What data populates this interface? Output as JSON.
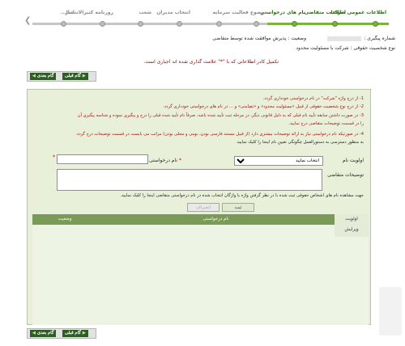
{
  "steps": [
    {
      "label": "اطلاعات عمومی شرکت",
      "done": true
    },
    {
      "label": "اطلاعات متقاضی",
      "done": true
    },
    {
      "label": "نام های درخواستی",
      "done": true
    },
    {
      "label": "موضوع فعالیت",
      "done": false
    },
    {
      "label": "سرمایه",
      "done": false
    },
    {
      "label": "انتخاب مدیران",
      "done": false
    },
    {
      "label": "شعب",
      "done": false
    },
    {
      "label": "روزنامه کثیرالانتشار",
      "done": false
    },
    {
      "label": "اسا...",
      "done": false
    }
  ],
  "info": {
    "tracking_label": "شماره پیگیری :",
    "status_label": "وضعیت : پذیرش موافقت شده توسط متقاضی",
    "entity_type": "نوع شخصیت حقوقی : شرکت با مسئولیت محدود",
    "instruction": "تکمیل کادر اطلاعاتی که با \"*\" علامت گذاری شده اند اجباری است."
  },
  "nav": {
    "next_label": "گام بعدی",
    "prev_label": "گام قبلی"
  },
  "notes": [
    "1- از درج واژه \"شرکت\" در نام درخواستی خودداری گردد.",
    "2- از درج نوع شخصیت حقوقی از قبیل «مسئولیت محدود» و «تضامنی» و ... در نام های درخواستی خودداری گردد.",
    "3- در صورت داشتن سابقه تأیید نام قبلی که به دلیل قانونی دیگر، در مرحله ثبت تأیید شده باشد، صرفاً نام تأیید شده قبلی را درج و پیگیری نموده و شناسه پیگیری آن",
    "را در قسمت توضیحات متقاضی درج نمایید.",
    "4- در صورتیکه نام درخواستی نیاز به ارائه توضیحات بیشتری دارد (از قبیل مستند فارسی بودن، بومی و محلی بودن) مراتب می بایست در قسمت توضیحات درج گردد.",
    "به منظور دسترسی به دستورالعمل چگونگی تعیین نام اینجا را کلیک نمایید."
  ],
  "form": {
    "priority_label": "اولویت نام",
    "requested_name_label": "نام درخواستی",
    "select_placeholder": "انتخاب نمایید",
    "desc_label": "توضیحات متقاضی",
    "hint": "جهت مشاهده نام های اشخاص حقوقی ثبت شده با در نظر گرفتن واژه یا واژگان انتخاب شده در نام درخواستی متقاضی اینجا را کلیک نمایید.",
    "submit_label": "ثبت",
    "cancel_label": "انصراف"
  },
  "table": {
    "priority": "اولویت",
    "name": "نام درخواستی",
    "status": "وضعیت",
    "edit": "ویرایش"
  }
}
